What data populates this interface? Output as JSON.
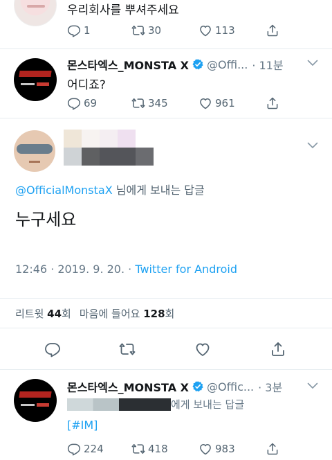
{
  "tweet1": {
    "text": "우리회사를 뿌셔주세요",
    "replies": "1",
    "retweets": "30",
    "likes": "113"
  },
  "tweet2": {
    "name": "몬스타엑스_MONSTA X",
    "handle": "@Offi...",
    "time": "· 11분",
    "text": "어디죠?",
    "replies": "69",
    "retweets": "345",
    "likes": "961"
  },
  "tweet3": {
    "reply_to_handle": "@OfficialMonstaX",
    "reply_to_suffix": " 님에게 보내는 답글",
    "text": "누구세요",
    "timestamp": "12:46 · 2019. 9. 20. · ",
    "source": "Twitter for Android"
  },
  "stats": {
    "retweet_label": "리트윗 ",
    "retweet_count": "44",
    "retweet_unit": "회",
    "like_label": "마음에 들어요 ",
    "like_count": "128",
    "like_unit": "회"
  },
  "tweet5": {
    "name": "몬스타엑스_MONSTA X",
    "handle": "@Offic...",
    "time": "· 3분",
    "reply_suffix": "에게 보내는 답글",
    "text": "[#IM]",
    "replies": "224",
    "retweets": "418",
    "likes": "983"
  },
  "colors": {
    "accent": "#1da1f2",
    "muted": "#657786",
    "text": "#14171a",
    "divider": "#e6ecf0"
  }
}
